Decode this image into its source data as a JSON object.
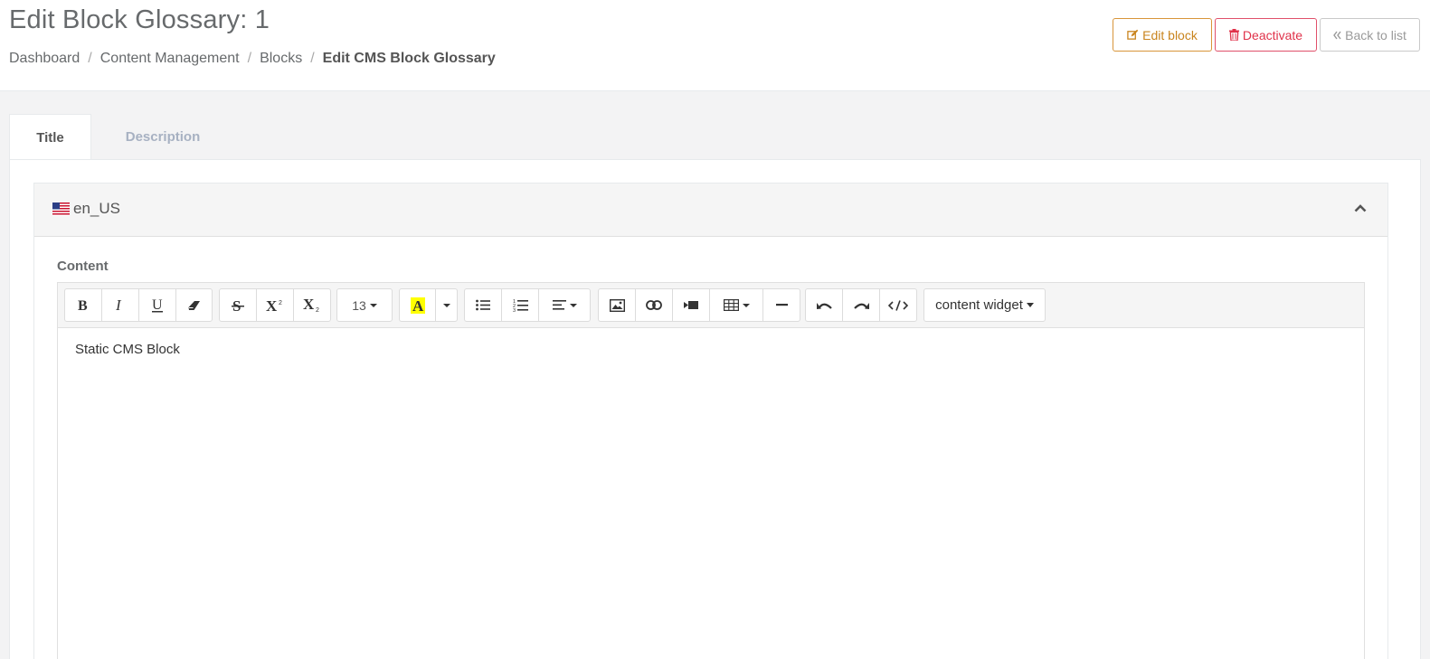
{
  "header": {
    "title": "Edit Block Glossary: 1",
    "breadcrumb": [
      "Dashboard",
      "Content Management",
      "Blocks"
    ],
    "breadcrumb_active": "Edit CMS Block Glossary",
    "breadcrumb_sep": "/",
    "buttons": {
      "edit": "Edit block",
      "deactivate": "Deactivate",
      "back": "Back to list"
    }
  },
  "tabs": [
    {
      "label": "Title",
      "active": true
    },
    {
      "label": "Description",
      "active": false
    }
  ],
  "locale": {
    "code": "en_US",
    "flag_icon": "us-flag-icon",
    "collapse_icon": "chevron-up-icon"
  },
  "editor": {
    "label": "Content",
    "font_size": "13",
    "widget_label": "content widget",
    "content": "Static CMS Block",
    "highlight_color": "#ffff00"
  },
  "colors": {
    "edit": "#c9841e",
    "deactivate": "#e0324a",
    "back": "#999999"
  }
}
